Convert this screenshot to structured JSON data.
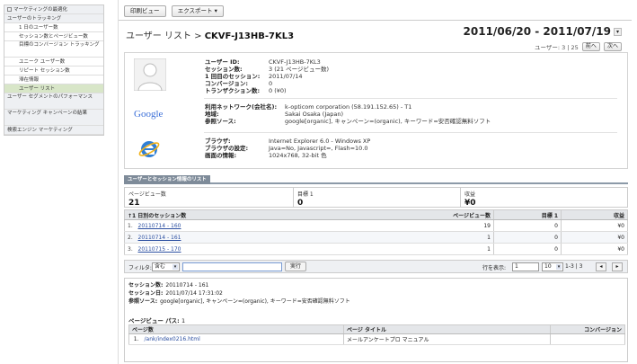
{
  "sidebar": {
    "items": [
      {
        "label": "マーケティングの最適化",
        "type": "head"
      },
      {
        "label": "ユーザーのトラッキング",
        "type": "head"
      },
      {
        "label": "1 日のユーザー数",
        "type": "sub"
      },
      {
        "label": "セッション数とページビュー数",
        "type": "sub"
      },
      {
        "label": "目標のコンバージョン トラッキング",
        "type": "sub-tall"
      },
      {
        "label": "ユニーク ユーザー数",
        "type": "sub"
      },
      {
        "label": "リピート セッション数",
        "type": "sub"
      },
      {
        "label": "滞在情報",
        "type": "sub"
      },
      {
        "label": "ユーザー リスト",
        "type": "sub-active"
      },
      {
        "label": "ユーザー セグメントのパフォーマンス",
        "type": "head-tall"
      },
      {
        "label": "マーケティング キャンペーンの結果",
        "type": "head-tall"
      },
      {
        "label": "検索エンジン マーケティング",
        "type": "head"
      }
    ]
  },
  "toolbar": {
    "print_label": "印刷ビュー",
    "export_label": "エクスポート ▾"
  },
  "header": {
    "title_prefix": "ユーザー リスト > ",
    "title_id": "CKVF-J13HB-7KL3",
    "date_range": "2011/06/20 - 2011/07/19",
    "pager_text": "ユーザー: 3 | 25",
    "prev_label": "前へ",
    "next_label": "次へ"
  },
  "profile": {
    "user": {
      "labels": [
        "ユーザー ID:",
        "セッション数:",
        "1 回目のセッション:",
        "コンバージョン:",
        "トランザクション数:"
      ],
      "values": [
        "CKVF-J13HB-7KL3",
        "3 (21 ページビュー数)",
        "2011/07/14",
        "0",
        "0 (¥0)"
      ]
    },
    "network": {
      "logo": "Google",
      "labels": [
        "利用ネットワーク(会社名):",
        "地域:",
        "参照ソース:"
      ],
      "values": [
        "k-opticom corporation (58.191.152.65) - T1",
        "Sakai Osaka (Japan)",
        "google[organic], キャンペーン=(organic), キーワード=安否確認無料ソフト"
      ]
    },
    "browser": {
      "labels": [
        "ブラウザ:",
        "ブラウザの設定:",
        "画面の情報:"
      ],
      "values": [
        "Internet Explorer 6.0 - Windows XP",
        "Java=No, Javascript=, Flash=10.0",
        "1024x768, 32-bit 色"
      ]
    }
  },
  "section_tab": "ユーザーとセッション情報のリスト",
  "metrics": [
    {
      "label": "ページビュー数",
      "value": "21"
    },
    {
      "label": "目標 1",
      "value": "0"
    },
    {
      "label": "収益",
      "value": "¥0"
    }
  ],
  "session_table": {
    "headers": [
      "1 日別のセッション数",
      "ページビュー数",
      "目標 1",
      "収益"
    ],
    "rows": [
      {
        "index": "1.",
        "session": "20110714 - 160",
        "pageviews": "19",
        "goal": "0",
        "revenue": "¥0"
      },
      {
        "index": "2.",
        "session": "20110714 - 161",
        "pageviews": "1",
        "goal": "0",
        "revenue": "¥0"
      },
      {
        "index": "3.",
        "session": "20110715 - 170",
        "pageviews": "1",
        "goal": "0",
        "revenue": "¥0"
      }
    ]
  },
  "filter": {
    "label": "フィルタ:",
    "mode": "含む",
    "value": "",
    "button": "実行",
    "rows_label": "行を表示:",
    "start_row": "1",
    "rows_per_page": "10",
    "range": "1-3 | 3"
  },
  "detail": {
    "lines": [
      {
        "label": "セッション数:",
        "value": "20110714 - 161"
      },
      {
        "label": "セッション日:",
        "value": "2011/07/14 17:31:02"
      },
      {
        "label": "参照ソース:",
        "value": "google[organic], キャンペーン=(organic), キーワード=安否確認無料ソフト"
      }
    ],
    "pv_path_label": "ページビュー パス:",
    "pv_path_count": "1",
    "pv_headers": [
      "ページ数",
      "ページ タイトル",
      "コンバージョン"
    ],
    "pv_rows": [
      {
        "index": "1.",
        "page": "/ank/index0216.html",
        "title": "メールアンケートプロ マニュアル",
        "conversion": ""
      }
    ]
  },
  "colors": {
    "accent": "#2a4ea0",
    "tab": "#7e8b99",
    "active_nav": "#d8e6c8",
    "header_bg": "#e4e6e9"
  }
}
